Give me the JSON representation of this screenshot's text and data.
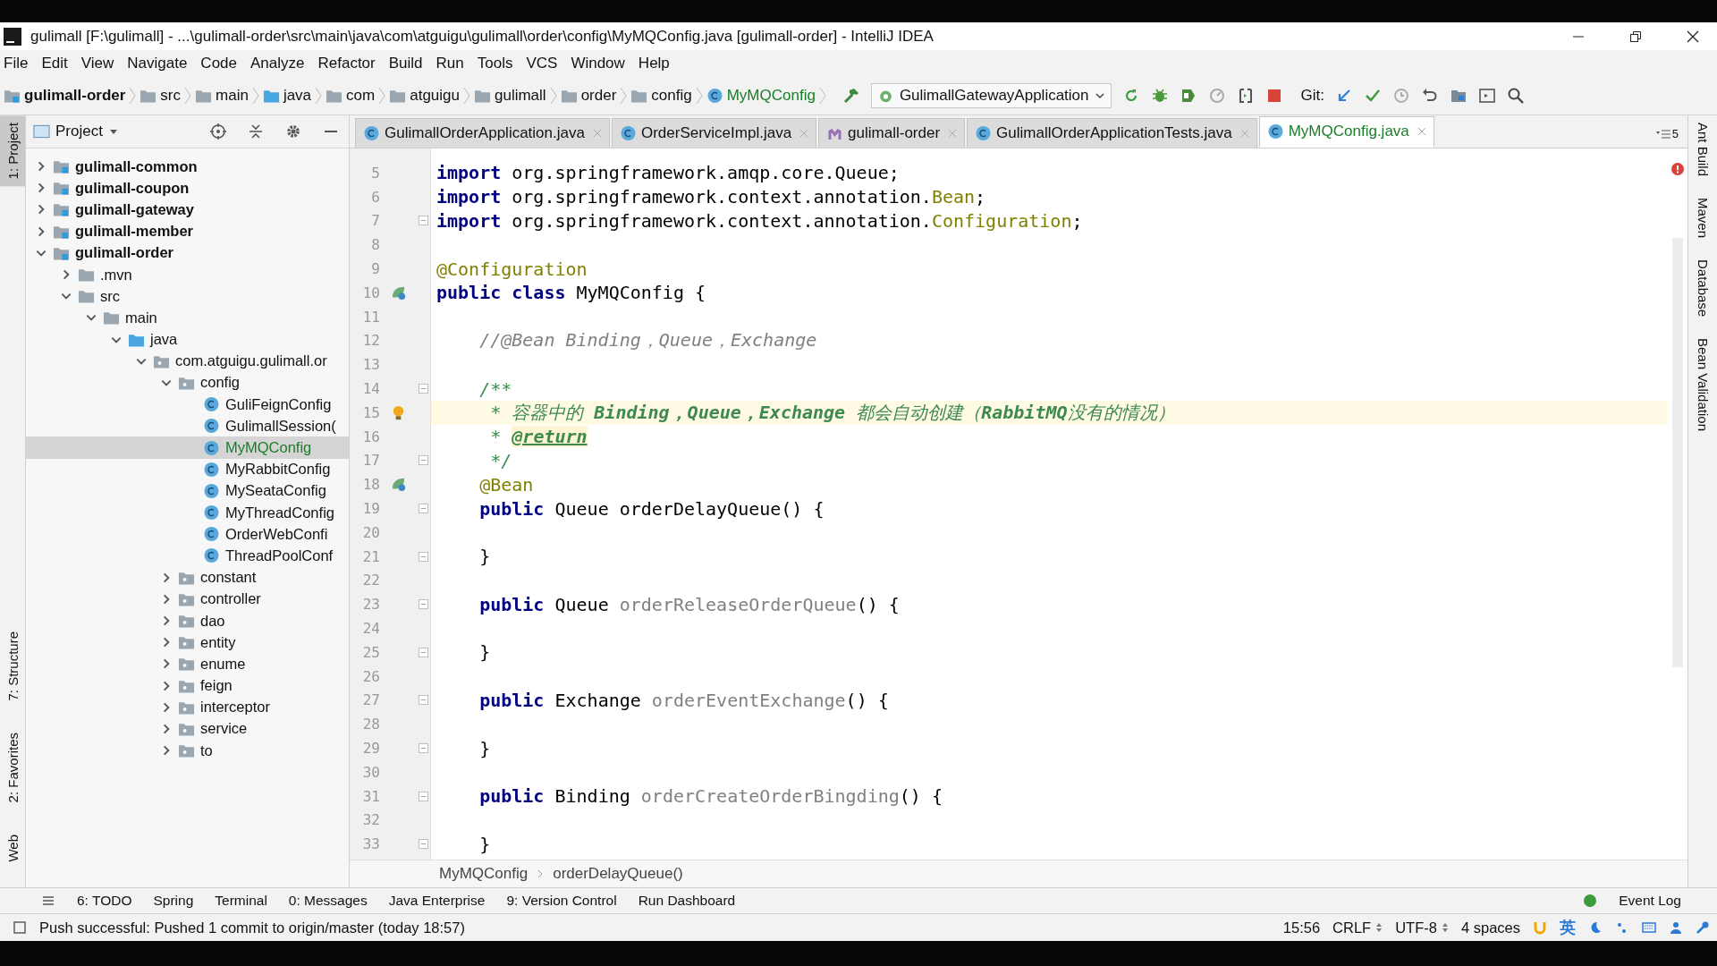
{
  "window": {
    "title": "gulimall [F:\\gulimall] - ...\\gulimall-order\\src\\main\\java\\com\\atguigu\\gulimall\\order\\config\\MyMQConfig.java [gulimall-order] - IntelliJ IDEA"
  },
  "menu": [
    "File",
    "Edit",
    "View",
    "Navigate",
    "Code",
    "Analyze",
    "Refactor",
    "Build",
    "Run",
    "Tools",
    "VCS",
    "Window",
    "Help"
  ],
  "nav_breadcrumbs": [
    {
      "label": "gulimall-order",
      "kind": "module"
    },
    {
      "label": "src",
      "kind": "folder"
    },
    {
      "label": "main",
      "kind": "folder"
    },
    {
      "label": "java",
      "kind": "source"
    },
    {
      "label": "com",
      "kind": "folder"
    },
    {
      "label": "atguigu",
      "kind": "folder"
    },
    {
      "label": "gulimall",
      "kind": "folder"
    },
    {
      "label": "order",
      "kind": "folder"
    },
    {
      "label": "config",
      "kind": "folder"
    },
    {
      "label": "MyMQConfig",
      "kind": "class"
    }
  ],
  "run_config": "GulimallGatewayApplication",
  "git_label": "Git:",
  "project_panel": {
    "title": "Project",
    "tree": [
      {
        "label": "gulimall-common",
        "kind": "module",
        "expanded": false,
        "selected": false
      },
      {
        "label": "gulimall-coupon",
        "kind": "module",
        "expanded": false,
        "selected": false
      },
      {
        "label": "gulimall-gateway",
        "kind": "module",
        "expanded": false,
        "selected": false
      },
      {
        "label": "gulimall-member",
        "kind": "module",
        "expanded": false,
        "selected": false
      },
      {
        "label": "gulimall-order",
        "kind": "module",
        "expanded": true,
        "selected": false,
        "children": [
          {
            "label": ".mvn",
            "kind": "folder",
            "expanded": false,
            "selected": false
          },
          {
            "label": "src",
            "kind": "folder",
            "expanded": true,
            "selected": false,
            "children": [
              {
                "label": "main",
                "kind": "folder",
                "expanded": true,
                "selected": false,
                "children": [
                  {
                    "label": "java",
                    "kind": "source",
                    "expanded": true,
                    "selected": false,
                    "children": [
                      {
                        "label": "com.atguigu.gulimall.or",
                        "kind": "package",
                        "expanded": true,
                        "selected": false,
                        "children": [
                          {
                            "label": "config",
                            "kind": "package",
                            "expanded": true,
                            "selected": false,
                            "children": [
                              {
                                "label": "GuliFeignConfig",
                                "kind": "class",
                                "selected": false
                              },
                              {
                                "label": "GulimallSession(",
                                "kind": "class",
                                "selected": false
                              },
                              {
                                "label": "MyMQConfig",
                                "kind": "class",
                                "selected": true
                              },
                              {
                                "label": "MyRabbitConfig",
                                "kind": "class",
                                "selected": false
                              },
                              {
                                "label": "MySeataConfig",
                                "kind": "class",
                                "selected": false
                              },
                              {
                                "label": "MyThreadConfig",
                                "kind": "class",
                                "selected": false
                              },
                              {
                                "label": "OrderWebConfi",
                                "kind": "class",
                                "selected": false
                              },
                              {
                                "label": "ThreadPoolConf",
                                "kind": "class",
                                "selected": false
                              }
                            ]
                          },
                          {
                            "label": "constant",
                            "kind": "package",
                            "expanded": false,
                            "selected": false
                          },
                          {
                            "label": "controller",
                            "kind": "package",
                            "expanded": false,
                            "selected": false
                          },
                          {
                            "label": "dao",
                            "kind": "package",
                            "expanded": false,
                            "selected": false
                          },
                          {
                            "label": "entity",
                            "kind": "package",
                            "expanded": false,
                            "selected": false
                          },
                          {
                            "label": "enume",
                            "kind": "package",
                            "expanded": false,
                            "selected": false
                          },
                          {
                            "label": "feign",
                            "kind": "package",
                            "expanded": false,
                            "selected": false
                          },
                          {
                            "label": "interceptor",
                            "kind": "package",
                            "expanded": false,
                            "selected": false
                          },
                          {
                            "label": "service",
                            "kind": "package",
                            "expanded": false,
                            "selected": false
                          },
                          {
                            "label": "to",
                            "kind": "package",
                            "expanded": false,
                            "selected": false
                          }
                        ]
                      }
                    ]
                  }
                ]
              }
            ]
          }
        ]
      }
    ]
  },
  "tabs": [
    {
      "label": "GulimallOrderApplication.java",
      "kind": "class",
      "selected": false
    },
    {
      "label": "OrderServiceImpl.java",
      "kind": "class",
      "selected": false
    },
    {
      "label": "gulimall-order",
      "kind": "maven",
      "selected": false
    },
    {
      "label": "GulimallOrderApplicationTests.java",
      "kind": "class",
      "selected": false
    },
    {
      "label": "MyMQConfig.java",
      "kind": "class",
      "selected": true
    }
  ],
  "tab_count": "5",
  "editor": {
    "lines": [
      {
        "number": "5",
        "current": false,
        "fold": false,
        "tokens": [
          {
            "kind": "kw",
            "t": "import"
          },
          {
            "kind": "plain",
            "t": " org.springframework.amqp.core.Queue;"
          }
        ]
      },
      {
        "number": "6",
        "current": false,
        "fold": false,
        "tokens": [
          {
            "kind": "kw",
            "t": "import"
          },
          {
            "kind": "plain",
            "t": " org.springframework.context.annotation."
          },
          {
            "kind": "ann",
            "t": "Bean"
          },
          {
            "kind": "plain",
            "t": ";"
          }
        ]
      },
      {
        "number": "7",
        "current": false,
        "fold": true,
        "tokens": [
          {
            "kind": "kw",
            "t": "import"
          },
          {
            "kind": "plain",
            "t": " org.springframework.context.annotation."
          },
          {
            "kind": "ann",
            "t": "Configuration"
          },
          {
            "kind": "plain",
            "t": ";"
          }
        ]
      },
      {
        "number": "8",
        "current": false,
        "fold": false
      },
      {
        "number": "9",
        "current": false,
        "fold": false,
        "tokens": [
          {
            "kind": "ann",
            "t": "@Configuration"
          }
        ]
      },
      {
        "number": "10",
        "current": false,
        "fold": false,
        "gutter": {
          "kind": "bean"
        },
        "tokens": [
          {
            "kind": "kw",
            "t": "public class"
          },
          {
            "kind": "plain",
            "t": " MyMQConfig {"
          }
        ]
      },
      {
        "number": "11",
        "current": false,
        "fold": false
      },
      {
        "number": "12",
        "current": false,
        "fold": false,
        "tokens": [
          {
            "kind": "comment",
            "t": "    //@Bean Binding，Queue，Exchange"
          }
        ]
      },
      {
        "number": "13",
        "current": false,
        "fold": false
      },
      {
        "number": "14",
        "current": false,
        "fold": true,
        "tokens": [
          {
            "kind": "doc",
            "t": "    /**"
          }
        ]
      },
      {
        "number": "15",
        "current": true,
        "fold": false,
        "gutter": {
          "kind": "bulb"
        },
        "tokens": [
          {
            "kind": "doc",
            "t": "     * 容器中的 "
          },
          {
            "kind": "docem",
            "t": "Binding，Queue，Exchange"
          },
          {
            "kind": "doc",
            "t": " 都会自动创建（"
          },
          {
            "kind": "docem",
            "t": "RabbitMQ"
          },
          {
            "kind": "doc",
            "t": "没有的情况）"
          }
        ]
      },
      {
        "number": "16",
        "current": false,
        "fold": false,
        "tokens": [
          {
            "kind": "doc",
            "t": "     * "
          },
          {
            "kind": "doctag",
            "t": "@return"
          }
        ]
      },
      {
        "number": "17",
        "current": false,
        "fold": true,
        "tokens": [
          {
            "kind": "doc",
            "t": "     */"
          }
        ]
      },
      {
        "number": "18",
        "current": false,
        "fold": false,
        "gutter": {
          "kind": "bean"
        },
        "tokens": [
          {
            "kind": "ann",
            "t": "    @Bean"
          }
        ]
      },
      {
        "number": "19",
        "current": false,
        "fold": true,
        "tokens": [
          {
            "kind": "kw",
            "t": "    public"
          },
          {
            "kind": "plain",
            "t": " Queue orderDelayQueue() {"
          }
        ]
      },
      {
        "number": "20",
        "current": false,
        "fold": false
      },
      {
        "number": "21",
        "current": false,
        "fold": true,
        "tokens": [
          {
            "kind": "plain",
            "t": "    }"
          }
        ]
      },
      {
        "number": "22",
        "current": false,
        "fold": false
      },
      {
        "number": "23",
        "current": false,
        "fold": true,
        "tokens": [
          {
            "kind": "kw",
            "t": "    public"
          },
          {
            "kind": "plain",
            "t": " Queue "
          },
          {
            "kind": "unused",
            "t": "orderReleaseOrderQueue"
          },
          {
            "kind": "plain",
            "t": "() {"
          }
        ]
      },
      {
        "number": "24",
        "current": false,
        "fold": false
      },
      {
        "number": "25",
        "current": false,
        "fold": true,
        "tokens": [
          {
            "kind": "plain",
            "t": "    }"
          }
        ]
      },
      {
        "number": "26",
        "current": false,
        "fold": false
      },
      {
        "number": "27",
        "current": false,
        "fold": true,
        "tokens": [
          {
            "kind": "kw",
            "t": "    public"
          },
          {
            "kind": "plain",
            "t": " Exchange "
          },
          {
            "kind": "unused",
            "t": "orderEventExchange"
          },
          {
            "kind": "plain",
            "t": "() {"
          }
        ]
      },
      {
        "number": "28",
        "current": false,
        "fold": false
      },
      {
        "number": "29",
        "current": false,
        "fold": true,
        "tokens": [
          {
            "kind": "plain",
            "t": "    }"
          }
        ]
      },
      {
        "number": "30",
        "current": false,
        "fold": false
      },
      {
        "number": "31",
        "current": false,
        "fold": true,
        "tokens": [
          {
            "kind": "kw",
            "t": "    public"
          },
          {
            "kind": "plain",
            "t": " Binding "
          },
          {
            "kind": "unused",
            "t": "orderCreateOrderBingding"
          },
          {
            "kind": "plain",
            "t": "() {"
          }
        ]
      },
      {
        "number": "32",
        "current": false,
        "fold": false
      },
      {
        "number": "33",
        "current": false,
        "fold": true,
        "tokens": [
          {
            "kind": "plain",
            "t": "    }"
          }
        ]
      }
    ],
    "breadcrumb": [
      "MyMQConfig",
      "orderDelayQueue()"
    ]
  },
  "left_stripe": [
    "1: Project",
    "7: Structure",
    "2: Favorites",
    "Web"
  ],
  "right_stripe": [
    "Ant Build",
    "Maven",
    "Database",
    "Bean Validation"
  ],
  "tool_windows": [
    "6: TODO",
    "Spring",
    "Terminal",
    "0: Messages",
    "Java Enterprise",
    "9: Version Control",
    "Run Dashboard"
  ],
  "event_log": "Event Log",
  "status_bar": {
    "message": "Push successful: Pushed 1 commit to origin/master (today 18:57)",
    "position": "15:56",
    "line_separator": "CRLF",
    "encoding": "UTF-8",
    "indent": "4 spaces",
    "ime": "英"
  }
}
